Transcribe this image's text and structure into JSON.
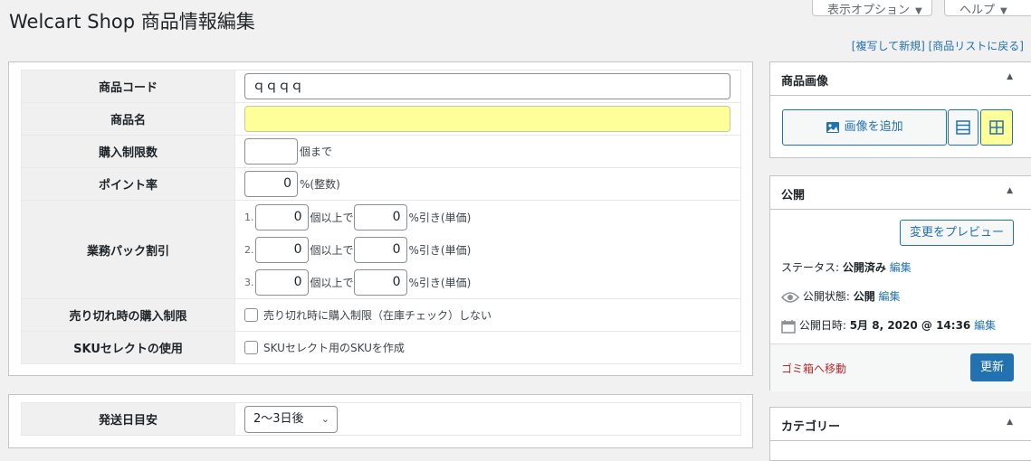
{
  "header": {
    "title": "Welcart Shop 商品情報編集",
    "screen_options": "表示オプション",
    "help": "ヘルプ",
    "copy_link": "[複写して新規]",
    "list_link": "[商品リストに戻る]"
  },
  "item_form": {
    "item_code": {
      "label": "商品コード",
      "value": "ｑｑｑｑ"
    },
    "item_name": {
      "label": "商品名",
      "value": ""
    },
    "purchase_limit": {
      "label": "購入制限数",
      "value": "",
      "unit": "個まで"
    },
    "point_rate": {
      "label": "ポイント率",
      "value": "0",
      "unit": "%(整数)"
    },
    "bulk_discount": {
      "label": "業務パック割引",
      "rows": [
        {
          "index": "1.",
          "qty": "0",
          "qty_unit": "個以上で",
          "rate": "0",
          "rate_unit": "%引き(単価)"
        },
        {
          "index": "2.",
          "qty": "0",
          "qty_unit": "個以上で",
          "rate": "0",
          "rate_unit": "%引き(単価)"
        },
        {
          "index": "3.",
          "qty": "0",
          "qty_unit": "個以上で",
          "rate": "0",
          "rate_unit": "%引き(単価)"
        }
      ]
    },
    "soldout_limit": {
      "label": "売り切れ時の購入制限",
      "checkbox_label": "売り切れ時に購入制限（在庫チェック）しない"
    },
    "sku_select": {
      "label": "SKUセレクトの使用",
      "checkbox_label": "SKUセレクト用のSKUを作成"
    }
  },
  "shipping_form": {
    "ship_date": {
      "label": "発送日目安",
      "selected": "2〜3日後"
    }
  },
  "item_image": {
    "title": "商品画像",
    "add_button": "画像を追加",
    "list_view_icon": "list-icon",
    "grid_view_icon": "grid-icon"
  },
  "publish": {
    "title": "公開",
    "preview_button": "変更をプレビュー",
    "status_label": "ステータス:",
    "status_value": "公開済み",
    "visibility_label": "公開状態:",
    "visibility_value": "公開",
    "date_label": "公開日時:",
    "date_value": "5月 8, 2020 @ 14:36",
    "edit_link": "編集",
    "trash_link": "ゴミ箱へ移動",
    "update_button": "更新"
  },
  "category": {
    "title": "カテゴリー"
  },
  "colors": {
    "link": "#2271b1",
    "trash": "#b32d2e",
    "highlight": "#ffff99",
    "primary_button": "#2271b1"
  }
}
